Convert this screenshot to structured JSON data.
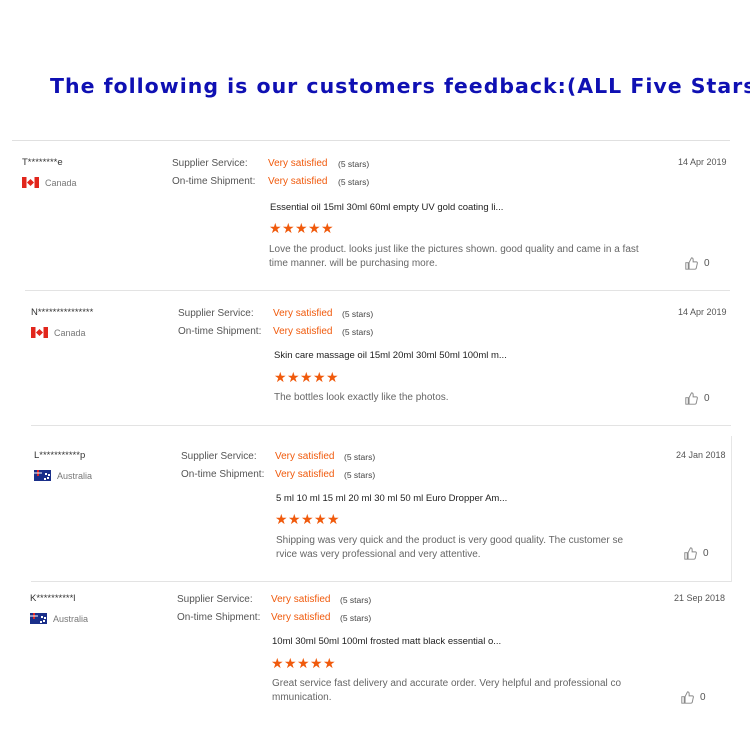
{
  "banner": {
    "text": "The following is our customers feedback:(ALL Five Stars)"
  },
  "labels": {
    "supplier_service": "Supplier Service:",
    "ontime_shipment": "On-time Shipment:"
  },
  "colors": {
    "accent": "#f05a0c",
    "banner": "#0f10b3"
  },
  "reviews": [
    {
      "user": "T********e",
      "country": "Canada",
      "flag": "canada-flag-icon",
      "supplier_value": "Very satisfied",
      "supplier_stars": "(5 stars)",
      "shipment_value": "Very satisfied",
      "shipment_stars": "(5 stars)",
      "date": "14 Apr 2019",
      "product": "Essential oil 15ml 30ml 60ml empty UV gold coating li...",
      "rating": 5,
      "comment": "Love the product. looks just like the pictures shown. good quality and came in a fast time manner. will be purchasing more.",
      "likes": "0"
    },
    {
      "user": "N***************",
      "country": "Canada",
      "flag": "canada-flag-icon",
      "supplier_value": "Very satisfied",
      "supplier_stars": "(5 stars)",
      "shipment_value": "Very satisfied",
      "shipment_stars": "(5 stars)",
      "date": "14 Apr 2019",
      "product": "Skin care massage oil 15ml 20ml 30ml 50ml 100ml m...",
      "rating": 5,
      "comment": "The bottles look exactly like the photos.",
      "likes": "0"
    },
    {
      "user": "L***********p",
      "country": "Australia",
      "flag": "australia-flag-icon",
      "supplier_value": "Very satisfied",
      "supplier_stars": "(5 stars)",
      "shipment_value": "Very satisfied",
      "shipment_stars": "(5 stars)",
      "date": "24 Jan 2018",
      "product": "5 ml 10 ml 15 ml 20 ml 30 ml 50 ml Euro Dropper Am...",
      "rating": 5,
      "comment": "Shipping was very quick and the product is very good quality. The customer se rvice was very professional and very attentive.",
      "likes": "0"
    },
    {
      "user": "K**********l",
      "country": "Australia",
      "flag": "australia-flag-icon",
      "supplier_value": "Very satisfied",
      "supplier_stars": "(5 stars)",
      "shipment_value": "Very satisfied",
      "shipment_stars": "(5 stars)",
      "date": "21 Sep 2018",
      "product": "10ml 30ml 50ml 100ml frosted matt black essential o...",
      "rating": 5,
      "comment": "Great service fast delivery and accurate order. Very helpful and professional co mmunication.",
      "likes": "0"
    }
  ]
}
